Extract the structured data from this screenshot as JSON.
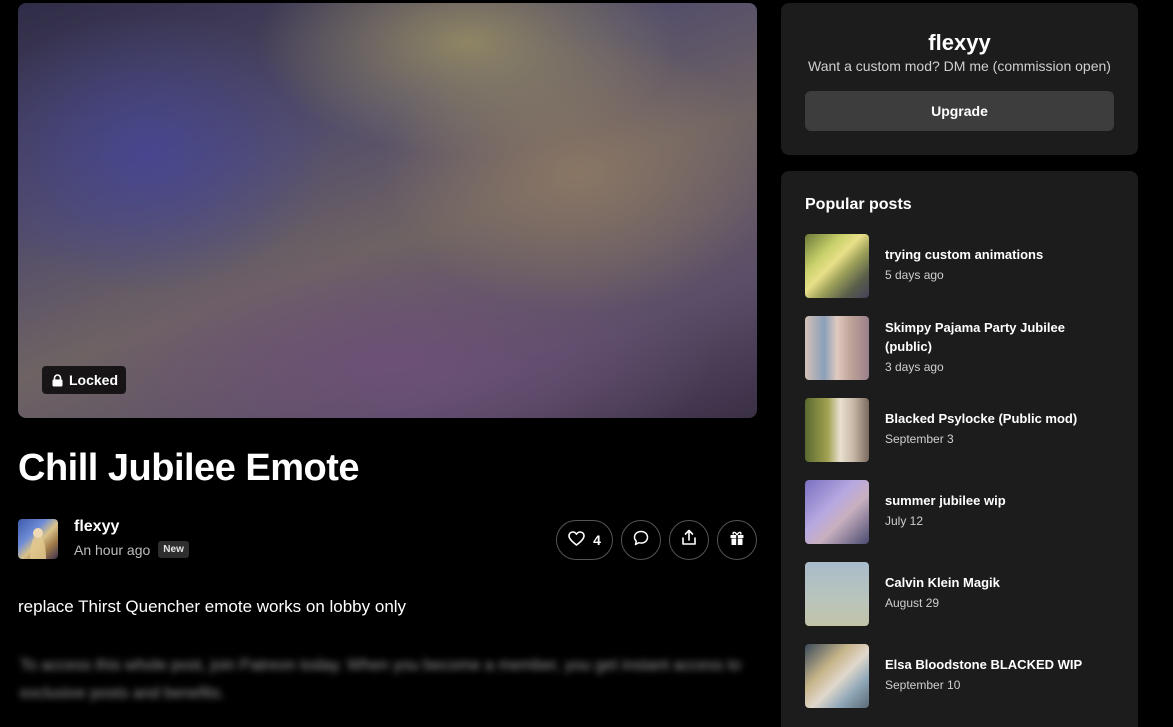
{
  "post": {
    "locked_label": "Locked",
    "title": "Chill Jubilee Emote",
    "author": "flexyy",
    "time_ago": "An hour ago",
    "new_badge": "New",
    "like_count": "4",
    "excerpt": "replace Thirst Quencher emote works on lobby only",
    "blurred_text": "To access this whole post, join Patreon today. When you become a member, you get instant access to exclusive posts and benefits."
  },
  "creator": {
    "name": "flexyy",
    "tagline": "Want a custom mod? DM me (commission open)",
    "upgrade_label": "Upgrade"
  },
  "popular": {
    "heading": "Popular posts",
    "items": [
      {
        "title": "trying custom animations",
        "date": "5 days ago"
      },
      {
        "title": "Skimpy Pajama Party Jubilee (public)",
        "date": "3 days ago"
      },
      {
        "title": "Blacked Psylocke (Public mod)",
        "date": "September 3"
      },
      {
        "title": "summer jubilee wip",
        "date": "July 12"
      },
      {
        "title": "Calvin Klein Magik",
        "date": "August 29"
      },
      {
        "title": "Elsa Bloodstone BLACKED WIP",
        "date": "September 10"
      }
    ]
  },
  "icons": {
    "lock": "lock-icon",
    "like": "heart-icon",
    "comment": "comment-bubble-icon",
    "share": "share-icon",
    "gift": "gift-icon"
  }
}
